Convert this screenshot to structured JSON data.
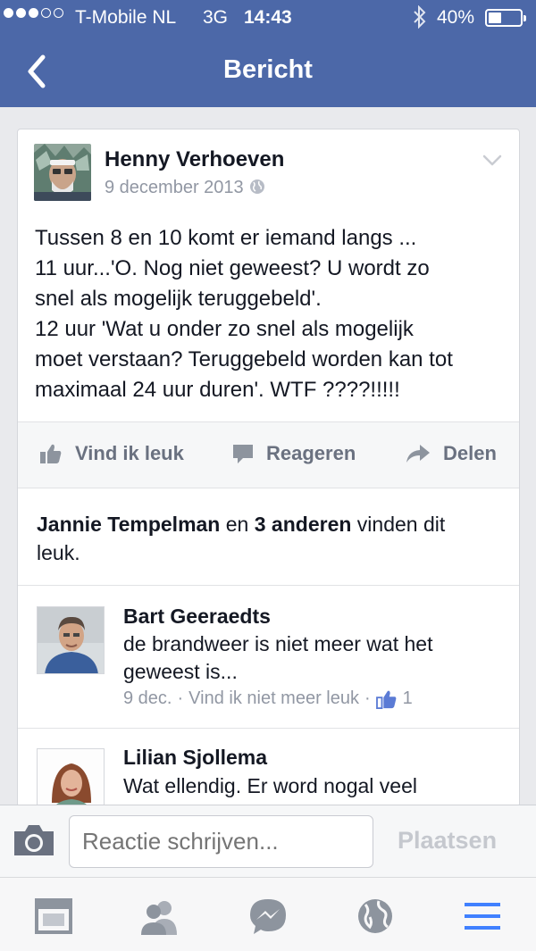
{
  "status_bar": {
    "carrier": "T-Mobile NL",
    "network": "3G",
    "time": "14:43",
    "battery": "40%",
    "battery_level": 0.4,
    "signal_bars_filled": 3,
    "signal_bars_total": 5
  },
  "nav": {
    "title": "Bericht",
    "back_icon": "chevron-left-icon"
  },
  "post": {
    "author": "Henny Verhoeven",
    "date": "9 december 2013",
    "privacy_icon": "globe-icon",
    "lines": [
      "Tussen 8 en 10 komt er iemand langs  ...",
      "11 uur...'O. Nog niet geweest? U wordt zo",
      "snel als mogelijk teruggebeld'.",
      "12 uur 'Wat u onder zo snel als mogelijk",
      "moet verstaan? Teruggebeld worden kan tot",
      "maximaal 24 uur duren'. WTF ????!!!!!"
    ]
  },
  "actions": {
    "like": "Vind ik leuk",
    "comment": "Reageren",
    "share": "Delen"
  },
  "likes_summary": {
    "name": "Jannie Tempelman",
    "connector": " en ",
    "others": "3 anderen",
    "suffix1": " vinden dit",
    "suffix2": "leuk."
  },
  "comments": [
    {
      "author": "Bart Geeraedts",
      "line1": "de brandweer is niet meer wat het",
      "line2": "geweest is...",
      "date": "9 dec.",
      "separator": " · ",
      "unlike": "Vind ik niet meer leuk",
      "likes": "1"
    },
    {
      "author": "Lilian Sjollema",
      "line1": "Wat ellendig. Er word nogal veel"
    }
  ],
  "composer": {
    "placeholder": "Reactie schrijven...",
    "post_label": "Plaatsen"
  },
  "tabbar": [
    "news-feed-icon",
    "friends-icon",
    "messenger-icon",
    "globe-icon",
    "menu-icon"
  ],
  "colors": {
    "brand": "#4c68a8",
    "link_blue": "#3b5998",
    "menu_active": "#4080ff"
  }
}
